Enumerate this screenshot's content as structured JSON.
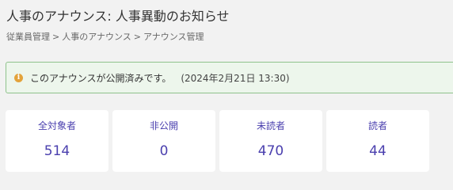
{
  "page": {
    "title": "人事のアナウンス: 人事異動のお知らせ"
  },
  "breadcrumb": {
    "items": [
      "従業員管理",
      "人事のアナウンス",
      "アナウンス管理"
    ],
    "separator": ">"
  },
  "notice": {
    "icon": "info-icon",
    "message": "このアナウンスが公開済みです。",
    "date": "(2024年2月21日 13:30)",
    "colors": {
      "background": "#edf6ec",
      "border": "#8fc28c",
      "icon": "#e3a33b"
    }
  },
  "stats": [
    {
      "label": "全対象者",
      "value": "514"
    },
    {
      "label": "非公開",
      "value": "0"
    },
    {
      "label": "未読者",
      "value": "470"
    },
    {
      "label": "読者",
      "value": "44"
    }
  ],
  "colors": {
    "accent": "#4a3fae",
    "page_background": "#f2f2f2"
  }
}
